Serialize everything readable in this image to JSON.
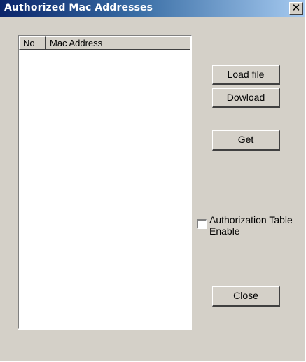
{
  "window": {
    "title": "Authorized Mac Addresses",
    "close_glyph": "✕"
  },
  "list": {
    "columns": [
      "No",
      "Mac Address"
    ],
    "rows": []
  },
  "buttons": {
    "load_file": "Load file",
    "download": "Dowload",
    "get": "Get",
    "close": "Close"
  },
  "authorization": {
    "label_line1": "Authorization Table",
    "label_line2": "Enable",
    "checked": false
  },
  "icons": {
    "close": "close-icon"
  }
}
